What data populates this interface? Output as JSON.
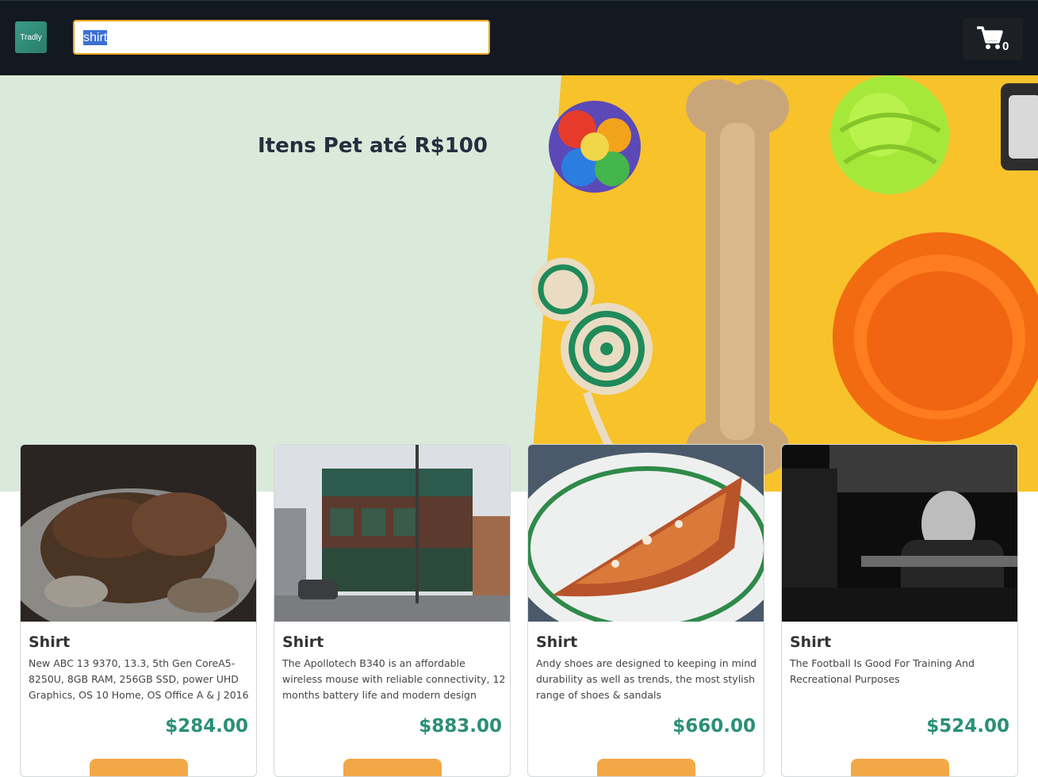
{
  "header": {
    "logo_text": "Tradly",
    "search_value": "shirt",
    "cart_count": "0"
  },
  "hero": {
    "title": "Itens Pet até R$100"
  },
  "products": [
    {
      "title": "Shirt",
      "description": "New ABC 13 9370, 13.3, 5th Gen CoreA5-8250U, 8GB RAM, 256GB SSD, power UHD Graphics, OS 10 Home, OS Office A & J 2016",
      "price": "$284.00"
    },
    {
      "title": "Shirt",
      "description": "The Apollotech B340 is an affordable wireless mouse with reliable connectivity, 12 months battery life and modern design",
      "price": "$883.00"
    },
    {
      "title": "Shirt",
      "description": "Andy shoes are designed to keeping in mind durability as well as trends, the most stylish range of shoes & sandals",
      "price": "$660.00"
    },
    {
      "title": "Shirt",
      "description": "The Football Is Good For Training And Recreational Purposes",
      "price": "$524.00"
    }
  ],
  "colors": {
    "header_bg": "#131921",
    "search_border": "#f0a41d",
    "hero_bg": "#daeada",
    "price": "#2a8f77",
    "button": "#f3a847"
  }
}
